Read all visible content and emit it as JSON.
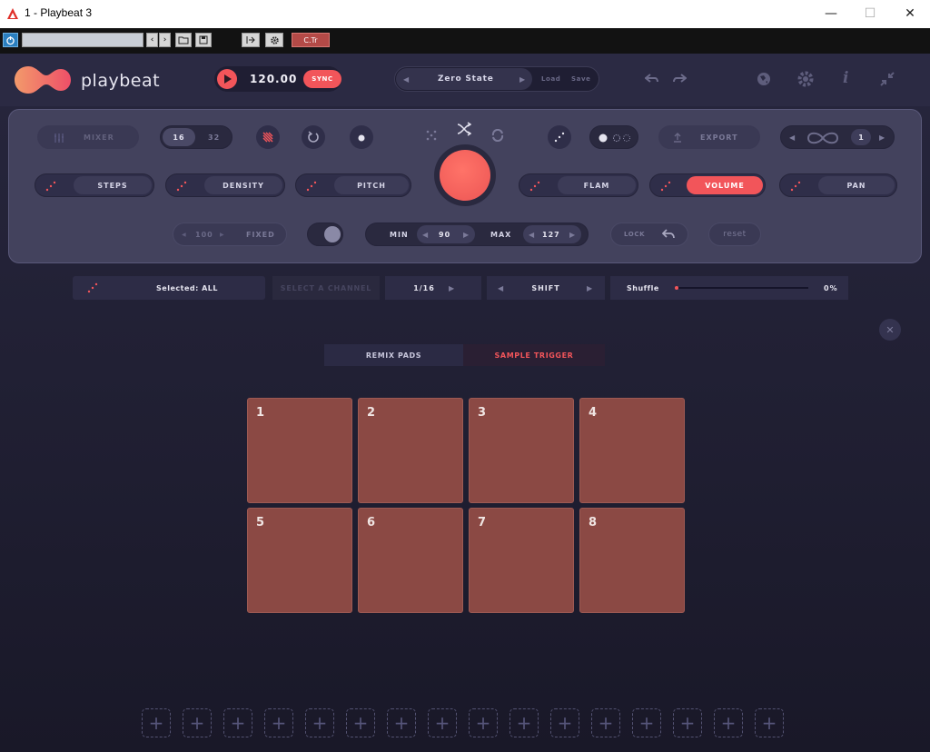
{
  "window": {
    "title": "1 - Playbeat 3",
    "minimize": "—",
    "maximize": "☐",
    "close": "✕"
  },
  "host": {
    "preset_label": "C.Tr"
  },
  "header": {
    "brand": "playbeat",
    "tempo": "120.00",
    "sync_label": "SYNC",
    "preset_name": "Zero State",
    "load_label": "Load",
    "save_label": "Save"
  },
  "panel": {
    "mixer_label": "MIXER",
    "steps_16": "16",
    "steps_32": "32",
    "export_label": "EXPORT",
    "loop_count": "1",
    "modes_left": [
      "STEPS",
      "DENSITY",
      "PITCH"
    ],
    "modes_right": [
      "FLAM",
      "VOLUME",
      "PAN"
    ],
    "fixed_value": "100",
    "fixed_label": "FIXED",
    "min_label": "MIN",
    "min_value": "90",
    "max_label": "MAX",
    "max_value": "127",
    "lock_label": "LOCK",
    "reset_label": "reset"
  },
  "channelbar": {
    "selected_label": "Selected: ALL",
    "select_channel": "SELECT A CHANNEL",
    "division": "1/16",
    "shift_label": "SHIFT",
    "shuffle_label": "Shuffle",
    "shuffle_value": "0%"
  },
  "tabs": {
    "remix": "REMIX PADS",
    "sample": "SAMPLE TRIGGER"
  },
  "pads": [
    "1",
    "2",
    "3",
    "4",
    "5",
    "6",
    "7",
    "8"
  ],
  "slots": 16,
  "colors": {
    "accent": "#f2555a",
    "pad": "#8b4944",
    "panel": "#43425d",
    "background": "#1f1e31"
  }
}
